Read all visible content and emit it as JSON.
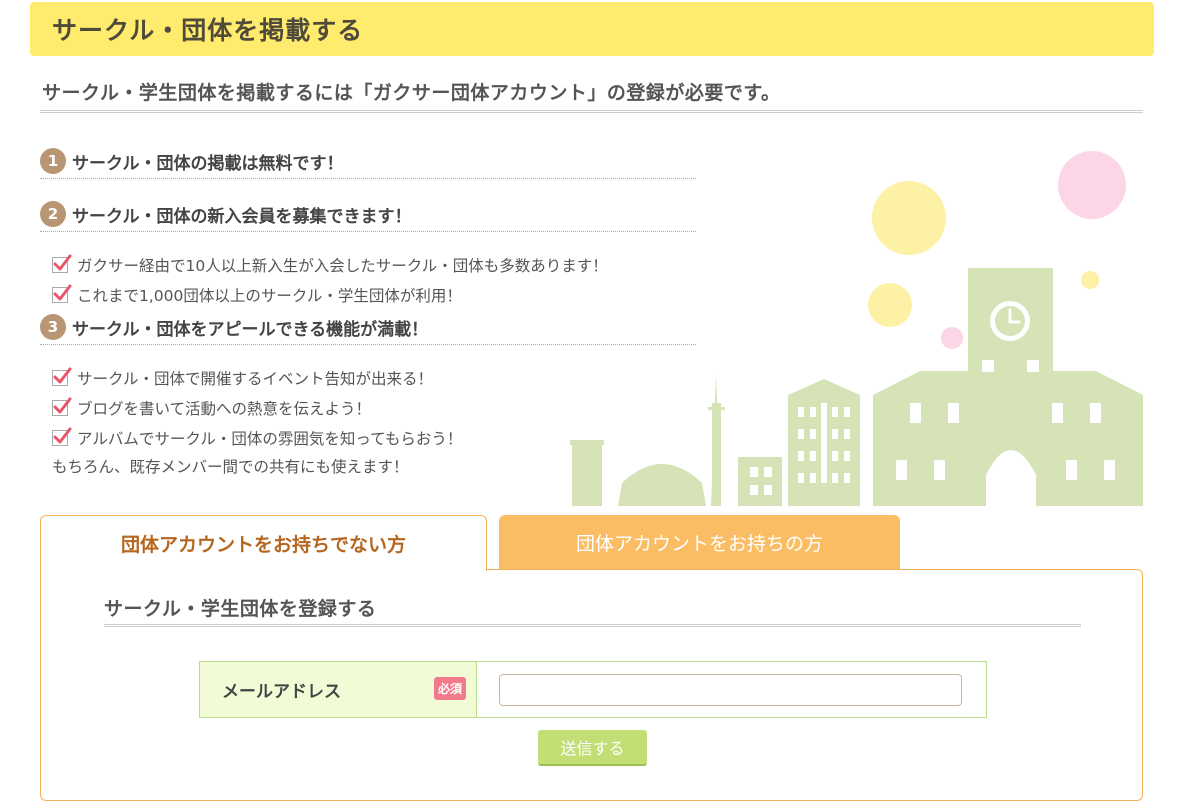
{
  "header": {
    "title": "サークル・団体を掲載する"
  },
  "lead": "サークル・学生団体を掲載するには「ガクサー団体アカウント」の登録が必要です。",
  "features": [
    {
      "number": "1",
      "title": "サークル・団体の掲載は無料です！",
      "items": []
    },
    {
      "number": "2",
      "title": "サークル・団体の新入会員を募集できます！",
      "items": [
        "ガクサー経由で10人以上新入生が入会したサークル・団体も多数あります！",
        "これまで1,000団体以上のサークル・学生団体が利用！"
      ]
    },
    {
      "number": "3",
      "title": "サークル・団体をアピールできる機能が満載！",
      "items": [
        "サークル・団体で開催するイベント告知が出来る！",
        "ブログを書いて活動への熱意を伝えよう！",
        "アルバムでサークル・団体の雰囲気を知ってもらおう！"
      ]
    }
  ],
  "note": "もちろん、既存メンバー間での共有にも使えます！",
  "tabs": [
    {
      "label": "団体アカウントをお持ちでない方",
      "active": true
    },
    {
      "label": "団体アカウントをお持ちの方",
      "active": false
    }
  ],
  "register": {
    "heading": "サークル・学生団体を登録する",
    "email_label": "メールアドレス",
    "required_label": "必須",
    "email_value": "",
    "submit_label": "送信する"
  },
  "colors": {
    "header_bg": "#ffeb6e",
    "badge": "#b89673",
    "tab_border": "#f3b15b",
    "tab_inactive": "#fbbd63",
    "form_bg": "#f1fbd6",
    "form_border": "#b9dc8d",
    "required": "#f27a8b",
    "submit": "#c2df76",
    "check_mark": "#e8566a",
    "illustration_green": "#d5e3b6"
  }
}
